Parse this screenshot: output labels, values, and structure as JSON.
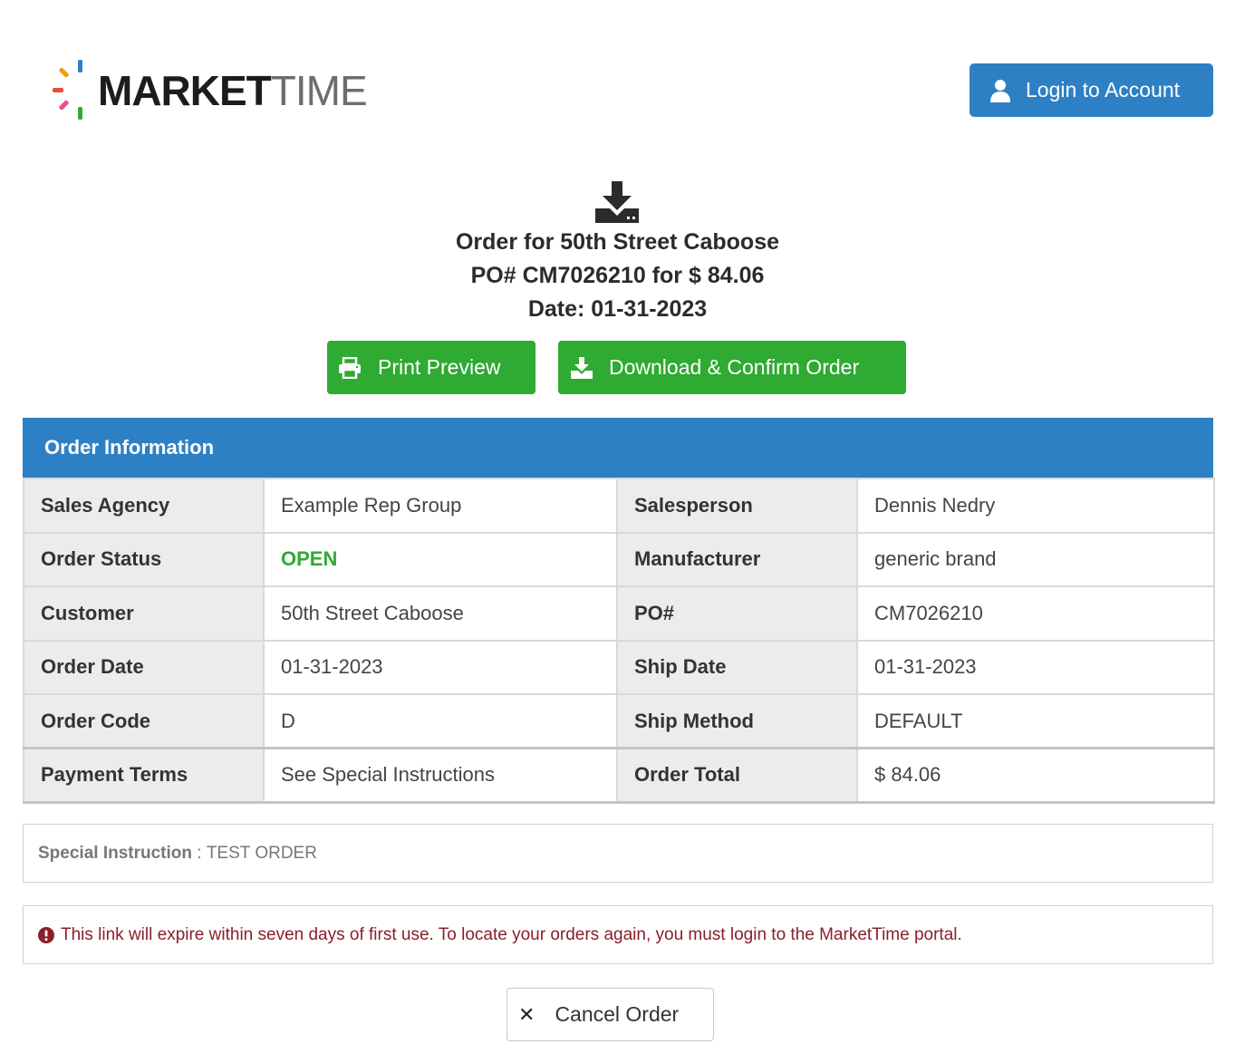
{
  "brand": {
    "logo_bold": "MARKET",
    "logo_light": "TIME"
  },
  "header": {
    "login_label": "Login to Account"
  },
  "order_summary": {
    "title": "Order for 50th Street Caboose",
    "po_line": "PO# CM7026210 for $ 84.06",
    "date_line": "Date: 01-31-2023"
  },
  "actions": {
    "print_label": "Print Preview",
    "download_label": "Download & Confirm Order",
    "cancel_label": "Cancel Order"
  },
  "order_info": {
    "heading": "Order Information",
    "rows": [
      {
        "l1": "Sales Agency",
        "v1": "Example Rep Group",
        "l2": "Salesperson",
        "v2": "Dennis Nedry"
      },
      {
        "l1": "Order Status",
        "v1": "OPEN",
        "l2": "Manufacturer",
        "v2": "generic brand"
      },
      {
        "l1": "Customer",
        "v1": "50th Street Caboose",
        "l2": "PO#",
        "v2": "CM7026210"
      },
      {
        "l1": "Order Date",
        "v1": "01-31-2023",
        "l2": "Ship Date",
        "v2": "01-31-2023"
      },
      {
        "l1": "Order Code",
        "v1": "D",
        "l2": "Ship Method",
        "v2": "DEFAULT"
      },
      {
        "l1": "Payment Terms",
        "v1": "See Special Instructions",
        "l2": "Order Total",
        "v2": "$ 84.06"
      }
    ]
  },
  "special_instruction": {
    "label": "Special Instruction",
    "separator": " : ",
    "text": "TEST ORDER"
  },
  "notice": {
    "text": "This link will expire within seven days of first use. To locate your orders again, you must login to the MarketTime portal."
  },
  "colors": {
    "primary": "#2e80c4",
    "success": "#2faa32",
    "warning_text": "#8a1f2a"
  }
}
